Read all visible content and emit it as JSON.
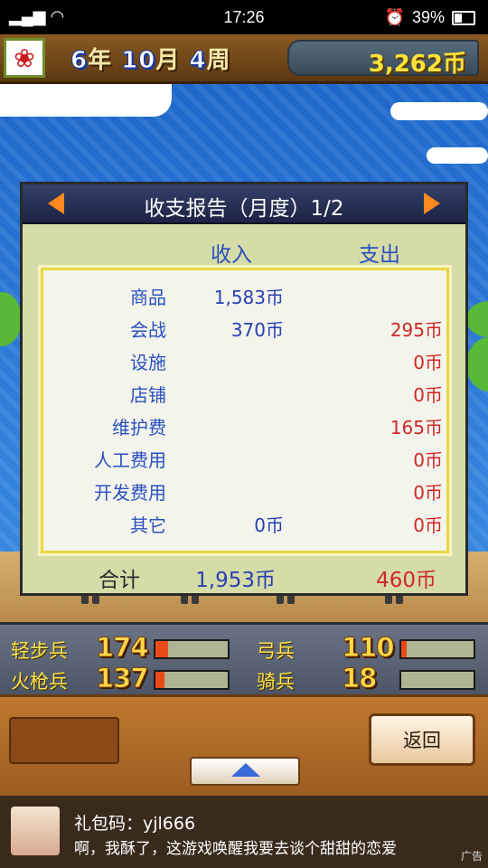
{
  "status_bar": {
    "time": "17:26",
    "battery": "39%"
  },
  "header": {
    "year": "6",
    "year_unit": "年",
    "month": "10",
    "month_unit": "月",
    "week": "4",
    "week_unit": "周",
    "coins": "3,262币"
  },
  "report": {
    "title": "收支报告（月度）1/2",
    "income_header": "收入",
    "expense_header": "支出",
    "rows": [
      {
        "label": "商品",
        "income": "1,583币",
        "expense": ""
      },
      {
        "label": "会战",
        "income": "370币",
        "expense": "295币"
      },
      {
        "label": "设施",
        "income": "",
        "expense": "0币"
      },
      {
        "label": "店铺",
        "income": "",
        "expense": "0币"
      },
      {
        "label": "维护费",
        "income": "",
        "expense": "165币"
      },
      {
        "label": "人工费用",
        "income": "",
        "expense": "0币"
      },
      {
        "label": "开发费用",
        "income": "",
        "expense": "0币"
      },
      {
        "label": "其它",
        "income": "0币",
        "expense": "0币"
      }
    ],
    "total_label": "合计",
    "total_income": "1,953币",
    "total_expense": "460币"
  },
  "troops": [
    {
      "name": "轻步兵",
      "count": "174",
      "level": 0.18
    },
    {
      "name": "弓兵",
      "count": "110",
      "level": 0.08
    },
    {
      "name": "火枪兵",
      "count": "137",
      "level": 0.12
    },
    {
      "name": "骑兵",
      "count": "18",
      "level": 0.0
    }
  ],
  "bottom": {
    "back_label": "返回"
  },
  "ad": {
    "line1": "礼包码：yjl666",
    "line2": "啊，我酥了，这游戏唤醒我要去谈个甜甜的恋爱",
    "tag": "广告"
  },
  "colors": {
    "accent_orange": "#ff8a1e",
    "income_blue": "#2a40b0",
    "expense_red": "#d02828",
    "coin_yellow": "#ffe23a"
  }
}
